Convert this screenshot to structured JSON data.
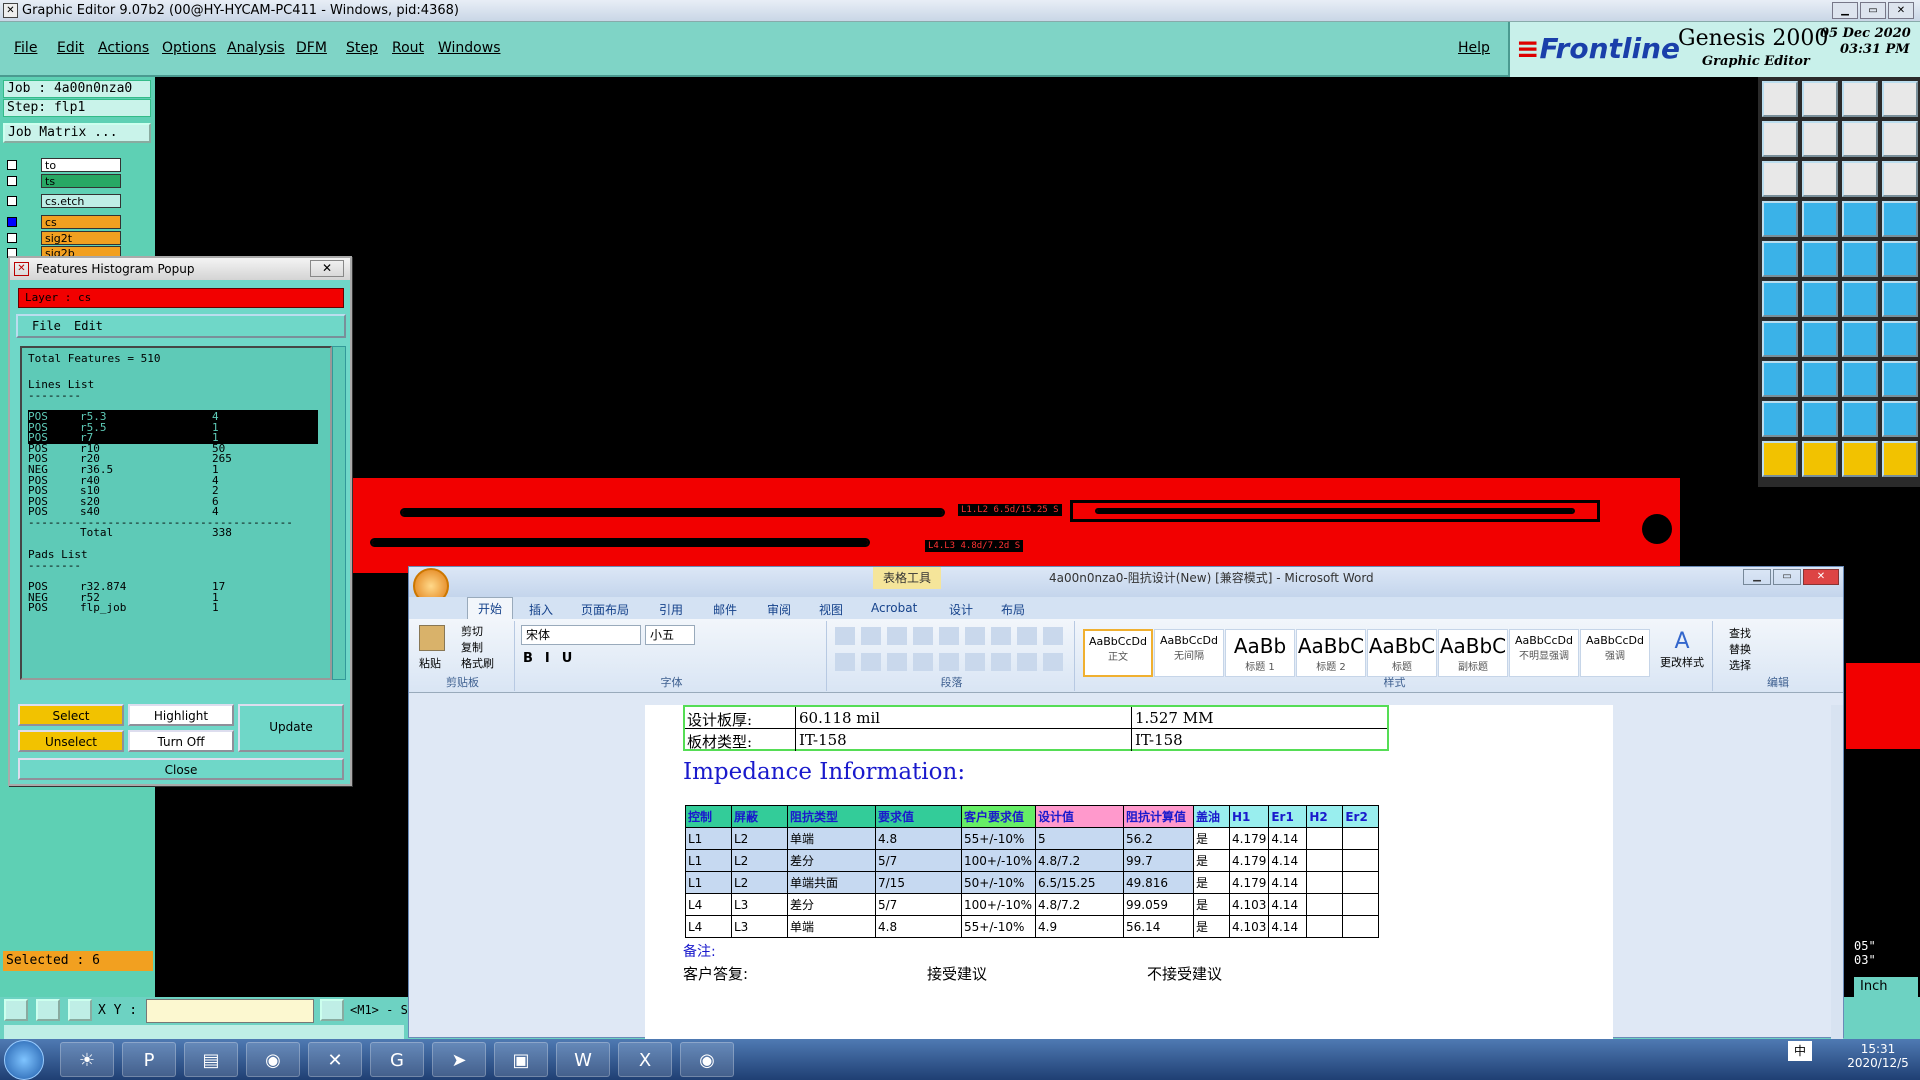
{
  "genesis": {
    "title": "Graphic Editor 9.07b2 (00@HY-HYCAM-PC411 - Windows, pid:4368)",
    "menu": [
      "File",
      "Edit",
      "Actions",
      "Options",
      "Analysis",
      "DFM",
      "Step",
      "Rout",
      "Windows"
    ],
    "help": "Help",
    "brand": "Frontline",
    "product": "Genesis 2000",
    "subtitle": "Graphic Editor",
    "date": "05 Dec 2020",
    "time": "03:31 PM",
    "job_line": "Job : 4a00n0nza0",
    "step_line": "Step: flp1",
    "job_matrix": "Job Matrix ...",
    "layers": [
      "to",
      "ts",
      "cs.etch",
      "cs",
      "sig2t",
      "sig2b"
    ],
    "selected": "Selected : 6",
    "xy_label": "X Y :",
    "m1_label": "<M1> - S",
    "units": "Inch",
    "right_coords": [
      "05\"",
      "03\""
    ],
    "pcb_labels": [
      "L1.L2 6.5d/15.25 S",
      "L4.L3 4.8d/7.2d S"
    ]
  },
  "histogram": {
    "title": "Features Histogram Popup",
    "layer": "Layer :  cs",
    "menu": [
      "File",
      "Edit"
    ],
    "total_features": "Total Features = 510",
    "lines_title": "Lines List",
    "sep": "--------",
    "lines": [
      [
        "POS",
        "r5.3",
        "4"
      ],
      [
        "POS",
        "r5.5",
        "1"
      ],
      [
        "POS",
        "r7",
        "1"
      ],
      [
        "POS",
        "r10",
        "50"
      ],
      [
        "POS",
        "r20",
        "265"
      ],
      [
        "NEG",
        "r36.5",
        "1"
      ],
      [
        "POS",
        "r40",
        "4"
      ],
      [
        "POS",
        "s10",
        "2"
      ],
      [
        "POS",
        "s20",
        "6"
      ],
      [
        "POS",
        "s40",
        "4"
      ]
    ],
    "total_label": "Total",
    "total_value": "338",
    "pads_title": "Pads List",
    "pads": [
      [
        "POS",
        "r32.874",
        "17"
      ],
      [
        "NEG",
        "r52",
        "1"
      ],
      [
        "POS",
        "flp_job",
        "1"
      ]
    ],
    "buttons": {
      "select": "Select",
      "highlight": "Highlight",
      "update": "Update",
      "unselect": "Unselect",
      "turnoff": "Turn Off",
      "close": "Close"
    }
  },
  "word": {
    "title": "4a00n0nza0-阻抗设计(New) [兼容模式] - Microsoft Word",
    "table_tools": "表格工具",
    "tabs": [
      "开始",
      "插入",
      "页面布局",
      "引用",
      "邮件",
      "审阅",
      "视图",
      "Acrobat",
      "设计",
      "布局"
    ],
    "clipboard": {
      "paste": "粘贴",
      "cut": "剪切",
      "copy": "复制",
      "format": "格式刷",
      "label": "剪贴板"
    },
    "font": {
      "name": "宋体",
      "size": "小五",
      "label": "字体"
    },
    "para_label": "段落",
    "styles": [
      {
        "sample": "AaBbCcDd",
        "name": "正文"
      },
      {
        "sample": "AaBbCcDd",
        "name": "无间隔"
      },
      {
        "sample": "AaBb",
        "name": "标题 1"
      },
      {
        "sample": "AaBbC",
        "name": "标题 2"
      },
      {
        "sample": "AaBbC",
        "name": "标题"
      },
      {
        "sample": "AaBbC",
        "name": "副标题"
      },
      {
        "sample": "AaBbCcDd",
        "name": "不明显强调"
      },
      {
        "sample": "AaBbCcDd",
        "name": "强调"
      }
    ],
    "change_styles": "更改样式",
    "styles_label": "样式",
    "edit": {
      "find": "查找",
      "replace": "替换",
      "select": "选择",
      "label": "编辑"
    },
    "doc": {
      "thickness_label": "设计板厚:",
      "thickness_mil": "60.118 mil",
      "thickness_mm": "1.527 MM",
      "material_label": "板材类型:",
      "material_a": "IT-158",
      "material_b": "IT-158",
      "heading": "Impedance Information:",
      "headers": [
        "控制",
        "屏蔽",
        "阻抗类型",
        "要求值",
        "客户要求值",
        "设计值",
        "阻抗计算值",
        "盖油",
        "H1",
        "Er1",
        "H2",
        "Er2"
      ],
      "rows": [
        [
          "L1",
          "L2",
          "单端",
          "4.8",
          "55+/-10%",
          "5",
          "56.2",
          "是",
          "4.179",
          "4.14",
          "",
          ""
        ],
        [
          "L1",
          "L2",
          "差分",
          "5/7",
          "100+/-10%",
          "4.8/7.2",
          "99.7",
          "是",
          "4.179",
          "4.14",
          "",
          ""
        ],
        [
          "L1",
          "L2",
          "单端共面",
          "7/15",
          "50+/-10%",
          "6.5/15.25",
          "49.816",
          "是",
          "4.179",
          "4.14",
          "",
          ""
        ],
        [
          "L4",
          "L3",
          "差分",
          "5/7",
          "100+/-10%",
          "4.8/7.2",
          "99.059",
          "是",
          "4.103",
          "4.14",
          "",
          ""
        ],
        [
          "L4",
          "L3",
          "单端",
          "4.8",
          "55+/-10%",
          "4.9",
          "56.14",
          "是",
          "4.103",
          "4.14",
          "",
          ""
        ]
      ],
      "notes": "备注:",
      "reply": "客户答复:",
      "accept": "接受建议",
      "reject": "不接受建议"
    }
  },
  "taskbar": {
    "time": "15:31",
    "date": "2020/12/5",
    "ime": "中"
  }
}
